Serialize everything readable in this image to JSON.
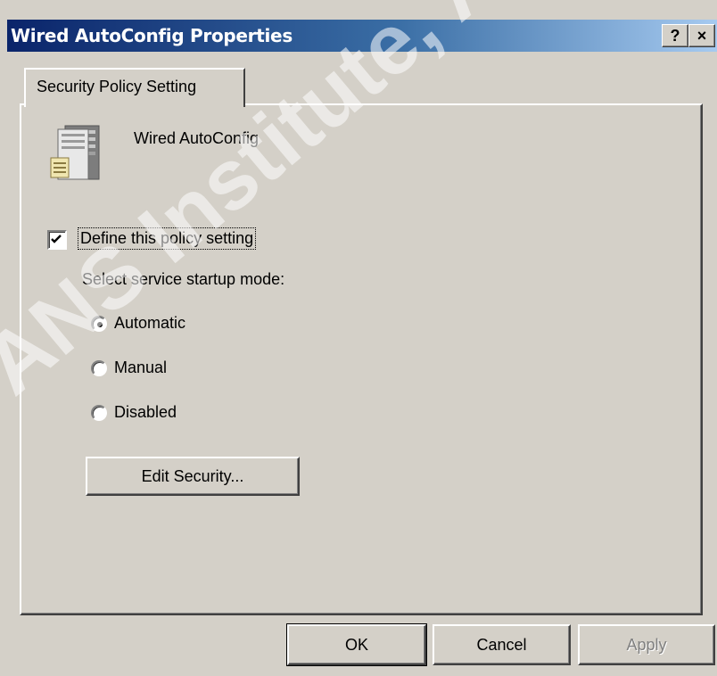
{
  "window": {
    "title": "Wired AutoConfig Properties",
    "help_button": "?",
    "close_button": "×"
  },
  "tabs": [
    {
      "label": "Security Policy Setting",
      "active": true
    }
  ],
  "service": {
    "name": "Wired AutoConfig",
    "icon": "server-icon"
  },
  "policy": {
    "define_label": "Define this policy setting",
    "define_checked": true,
    "startup_mode_label": "Select service startup mode:",
    "options": [
      {
        "label": "Automatic",
        "selected": true
      },
      {
        "label": "Manual",
        "selected": false
      },
      {
        "label": "Disabled",
        "selected": false
      }
    ],
    "edit_security_label": "Edit Security..."
  },
  "footer": {
    "ok_label": "OK",
    "cancel_label": "Cancel",
    "apply_label": "Apply",
    "apply_enabled": false
  },
  "watermark": "ANS Institute, Author retains",
  "colors": {
    "title_start": "#0a246a",
    "title_end": "#a6caf0",
    "face": "#d4d0c8"
  }
}
